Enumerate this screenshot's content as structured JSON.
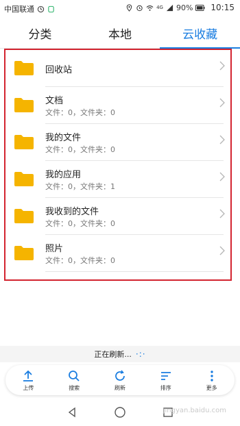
{
  "status_bar": {
    "carrier": "中国联通",
    "network": "4G",
    "battery": "90%",
    "time": "10:15"
  },
  "tabs": [
    {
      "label": "分类",
      "active": false
    },
    {
      "label": "本地",
      "active": false
    },
    {
      "label": "云收藏",
      "active": true
    }
  ],
  "list": [
    {
      "title": "回收站",
      "subtitle": ""
    },
    {
      "title": "文档",
      "subtitle": "文件：0，文件夹：0"
    },
    {
      "title": "我的文件",
      "subtitle": "文件：0，文件夹：0"
    },
    {
      "title": "我的应用",
      "subtitle": "文件：0，文件夹：1"
    },
    {
      "title": "我收到的文件",
      "subtitle": "文件：0，文件夹：0"
    },
    {
      "title": "照片",
      "subtitle": "文件：0，文件夹：0"
    }
  ],
  "refresh_status": "正在刷新...",
  "toolbar": [
    {
      "label": "上传",
      "icon": "upload-icon"
    },
    {
      "label": "搜索",
      "icon": "search-icon"
    },
    {
      "label": "刷新",
      "icon": "refresh-icon"
    },
    {
      "label": "排序",
      "icon": "sort-icon"
    },
    {
      "label": "更多",
      "icon": "more-icon"
    }
  ],
  "colors": {
    "accent": "#1a7de0",
    "folder": "#f5b400",
    "highlight_frame": "#d3232f"
  },
  "watermark": "jingyan.baidu.com"
}
